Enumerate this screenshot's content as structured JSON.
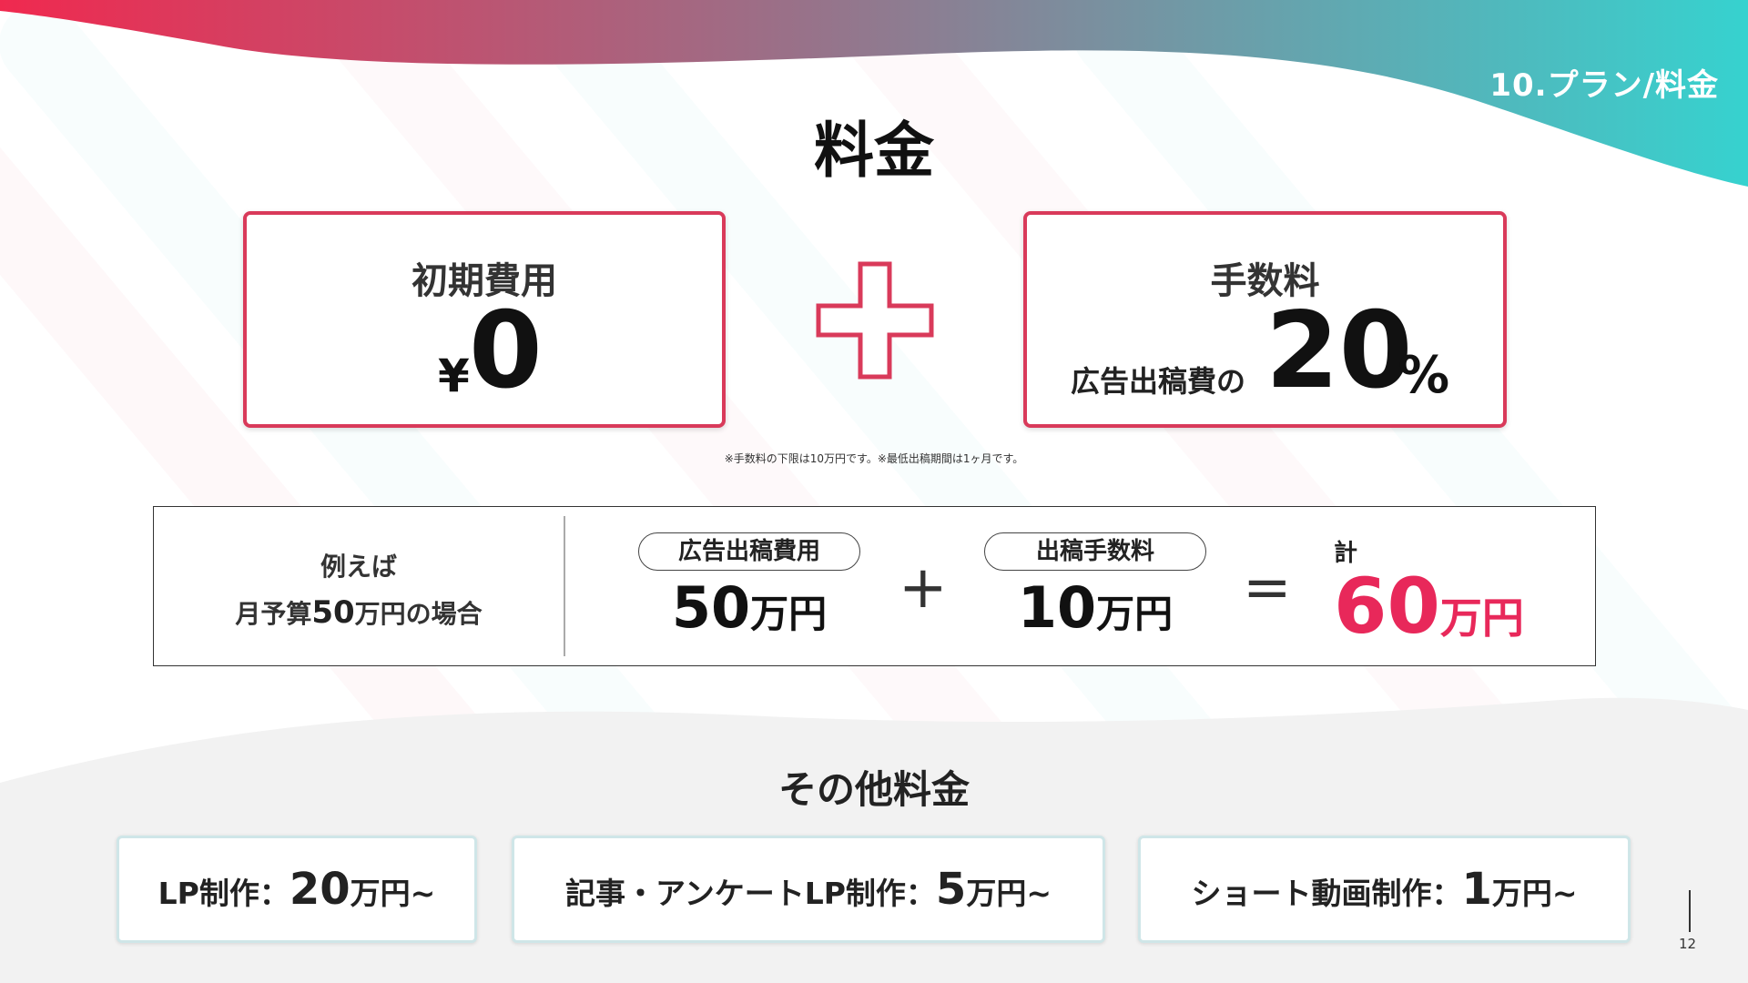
{
  "header": {
    "section_label": "10.プラン/料金",
    "title": "料金"
  },
  "pricing": {
    "initial": {
      "heading": "初期費用",
      "currency": "¥",
      "value": "0"
    },
    "commission": {
      "heading": "手数料",
      "prefix": "広告出稿費の",
      "value": "20",
      "unit": "%"
    },
    "plus_symbol": "plus-symbol",
    "footnote": "※手数料の下限は10万円です。※最低出稿期間は1ヶ月です。"
  },
  "example": {
    "intro_line1": "例えば",
    "intro_prefix": "月予算",
    "intro_number": "50",
    "intro_suffix": "万円の場合",
    "ad_cost": {
      "label": "広告出稿費用",
      "value": "50",
      "unit": "万円"
    },
    "plus": "+",
    "fee": {
      "label": "出稿手数料",
      "value": "10",
      "unit": "万円"
    },
    "equals": "=",
    "total": {
      "label": "計",
      "value": "60",
      "unit": "万円"
    }
  },
  "other": {
    "title": "その他料金",
    "items": [
      {
        "label": "LP制作：",
        "value": "20",
        "unit": "万円~"
      },
      {
        "label": "記事・アンケートLP制作：",
        "value": "5",
        "unit": "万円~"
      },
      {
        "label": "ショート動画制作：",
        "value": "1",
        "unit": "万円~"
      }
    ]
  },
  "page_number": "12",
  "colors": {
    "accent_red": "#e8285a",
    "border_red": "#d93a5a",
    "gradient_start": "#f0294f",
    "gradient_end": "#3ecfcf"
  }
}
